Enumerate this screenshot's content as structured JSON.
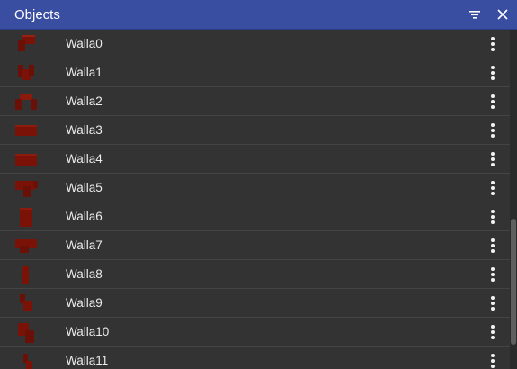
{
  "header": {
    "title": "Objects",
    "filter_icon": "filter-icon",
    "close_icon": "close-icon"
  },
  "objects": [
    {
      "name": "Walla0"
    },
    {
      "name": "Walla1"
    },
    {
      "name": "Walla2"
    },
    {
      "name": "Walla3"
    },
    {
      "name": "Walla4"
    },
    {
      "name": "Walla5"
    },
    {
      "name": "Walla6"
    },
    {
      "name": "Walla7"
    },
    {
      "name": "Walla8"
    },
    {
      "name": "Walla9"
    },
    {
      "name": "Walla10"
    },
    {
      "name": "Walla11"
    }
  ],
  "row_menu_icon": "more-vertical-icon",
  "colors": {
    "header_bg": "#3a4ea1",
    "panel_bg": "#2d2d2d",
    "row_bg": "#333333",
    "text": "#ececec",
    "thumb_red": "#7a1208"
  }
}
